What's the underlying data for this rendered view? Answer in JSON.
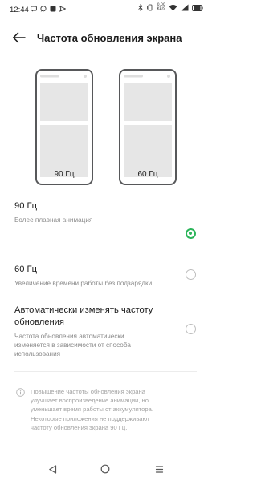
{
  "status_bar": {
    "time": "12:44",
    "left_icons": [
      "message-icon",
      "message-circle-icon",
      "app-square-icon",
      "send-icon"
    ],
    "right_icons": [
      "bluetooth-icon",
      "vibrate-icon",
      "network-speed-icon",
      "wifi-icon",
      "signal-icon",
      "battery-icon"
    ],
    "network_speed": {
      "value": "0,00",
      "unit": "KB/S"
    }
  },
  "header": {
    "title": "Частота обновления экрана",
    "back_icon": "arrow-left-icon"
  },
  "previews": [
    {
      "label": "90 Гц"
    },
    {
      "label": "60 Гц"
    }
  ],
  "options": [
    {
      "title": "90 Гц",
      "description": "Более плавная анимация",
      "selected": true
    },
    {
      "title": "60 Гц",
      "description": "Увеличение времени работы без подзарядки",
      "selected": false
    },
    {
      "title_lines": [
        "Автоматически изменять частоту",
        "обновления"
      ],
      "description_lines": [
        "Частота обновления автоматически",
        "изменяется в зависимости от способа",
        "использования"
      ],
      "selected": false
    }
  ],
  "info": {
    "icon": "info-icon",
    "lines": [
      "Повышение частоты обновления экрана",
      "улучшает воспроизведение анимации, но",
      "уменьшает время работы от аккумулятора.",
      "Некоторые приложения не поддерживают",
      "частоту обновления экрана 90 Гц."
    ]
  },
  "colors": {
    "accent": "#2bb55a",
    "text_primary": "#1b1b1b",
    "text_secondary": "#8a8a8a"
  },
  "navbar": {
    "icons": [
      "back-triangle-icon",
      "home-circle-icon",
      "menu-lines-icon"
    ]
  }
}
